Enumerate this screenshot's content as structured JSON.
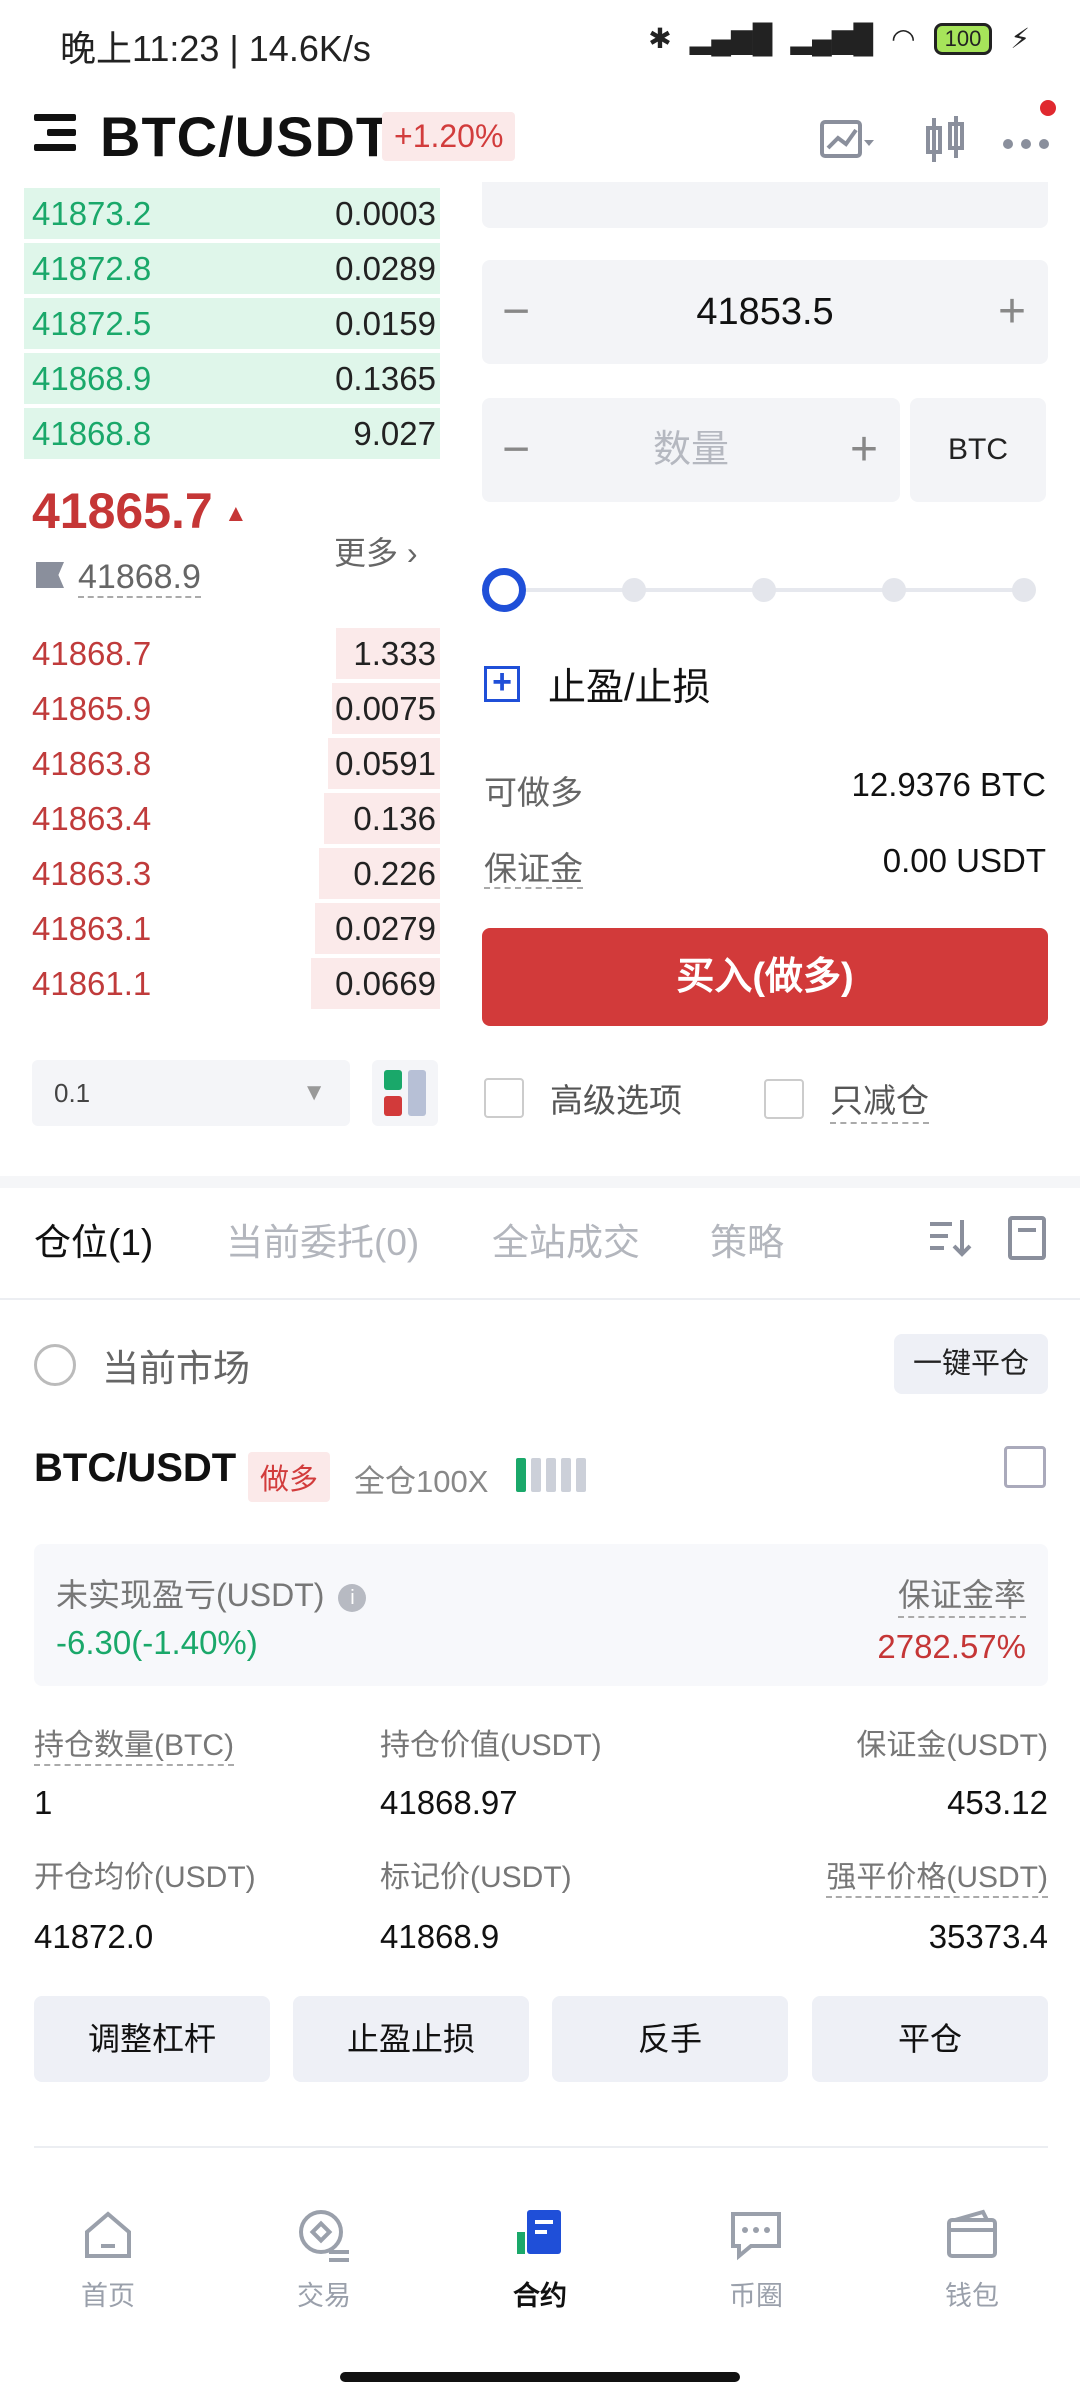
{
  "status_bar": {
    "time": "晚上11:23 | 14.6K/s",
    "battery": "100"
  },
  "header": {
    "pair": "BTC/USDT",
    "change": "+1.20%"
  },
  "order_book": {
    "asks": [
      {
        "price": "41873.2",
        "qty": "0.0003",
        "depth": 1.0
      },
      {
        "price": "41872.8",
        "qty": "0.0289",
        "depth": 1.0
      },
      {
        "price": "41872.5",
        "qty": "0.0159",
        "depth": 1.0
      },
      {
        "price": "41868.9",
        "qty": "0.1365",
        "depth": 1.0
      },
      {
        "price": "41868.8",
        "qty": "9.027",
        "depth": 1.0
      }
    ],
    "last_price": "41865.7",
    "more_label": "更多",
    "mark_price": "41868.9",
    "bids": [
      {
        "price": "41868.7",
        "qty": "1.333",
        "depth": 0.25
      },
      {
        "price": "41865.9",
        "qty": "0.0075",
        "depth": 0.26
      },
      {
        "price": "41863.8",
        "qty": "0.0591",
        "depth": 0.27
      },
      {
        "price": "41863.4",
        "qty": "0.136",
        "depth": 0.28
      },
      {
        "price": "41863.3",
        "qty": "0.226",
        "depth": 0.29
      },
      {
        "price": "41863.1",
        "qty": "0.0279",
        "depth": 0.3
      },
      {
        "price": "41861.1",
        "qty": "0.0669",
        "depth": 0.31
      }
    ],
    "depth_step": "0.1"
  },
  "order_form": {
    "price_value": "41853.5",
    "qty_placeholder": "数量",
    "unit": "BTC",
    "slider_percent": 0,
    "tpsl_label": "止盈/止损",
    "can_long_label": "可做多",
    "can_long_value": "12.9376 BTC",
    "margin_label": "保证金",
    "margin_value": "0.00 USDT",
    "buy_button": "买入(做多)",
    "advanced_label": "高级选项",
    "reduce_only_label": "只减仓"
  },
  "tabs": [
    {
      "label": "仓位(1)",
      "active": true
    },
    {
      "label": "当前委托(0)",
      "active": false
    },
    {
      "label": "全站成交",
      "active": false
    },
    {
      "label": "策略",
      "active": false
    }
  ],
  "positions": {
    "current_market_label": "当前市场",
    "close_all_label": "一键平仓",
    "pair": "BTC/USDT",
    "side": "做多",
    "leverage": "全仓100X",
    "leverage_level": 1,
    "unrealized_label": "未实现盈亏(USDT)",
    "unrealized_value": "-6.30(-1.40%)",
    "margin_ratio_label": "保证金率",
    "margin_ratio_value": "2782.57%",
    "fields": [
      {
        "label": "持仓数量(BTC)",
        "value": "1"
      },
      {
        "label": "持仓价值(USDT)",
        "value": "41868.97"
      },
      {
        "label": "保证金(USDT)",
        "value": "453.12"
      },
      {
        "label": "开仓均价(USDT)",
        "value": "41872.0"
      },
      {
        "label": "标记价(USDT)",
        "value": "41868.9"
      },
      {
        "label": "强平价格(USDT)",
        "value": "35373.4"
      }
    ],
    "actions": [
      "调整杠杆",
      "止盈止损",
      "反手",
      "平仓"
    ]
  },
  "bottom_nav": [
    {
      "label": "首页",
      "icon": "home-icon",
      "active": false
    },
    {
      "label": "交易",
      "icon": "trade-icon",
      "active": false
    },
    {
      "label": "合约",
      "icon": "contract-icon",
      "active": true
    },
    {
      "label": "币圈",
      "icon": "chat-icon",
      "active": false
    },
    {
      "label": "钱包",
      "icon": "wallet-icon",
      "active": false
    }
  ],
  "colors": {
    "buy_green": "#1aa86a",
    "sell_red": "#c53636",
    "accent_blue": "#1f4fd8"
  }
}
